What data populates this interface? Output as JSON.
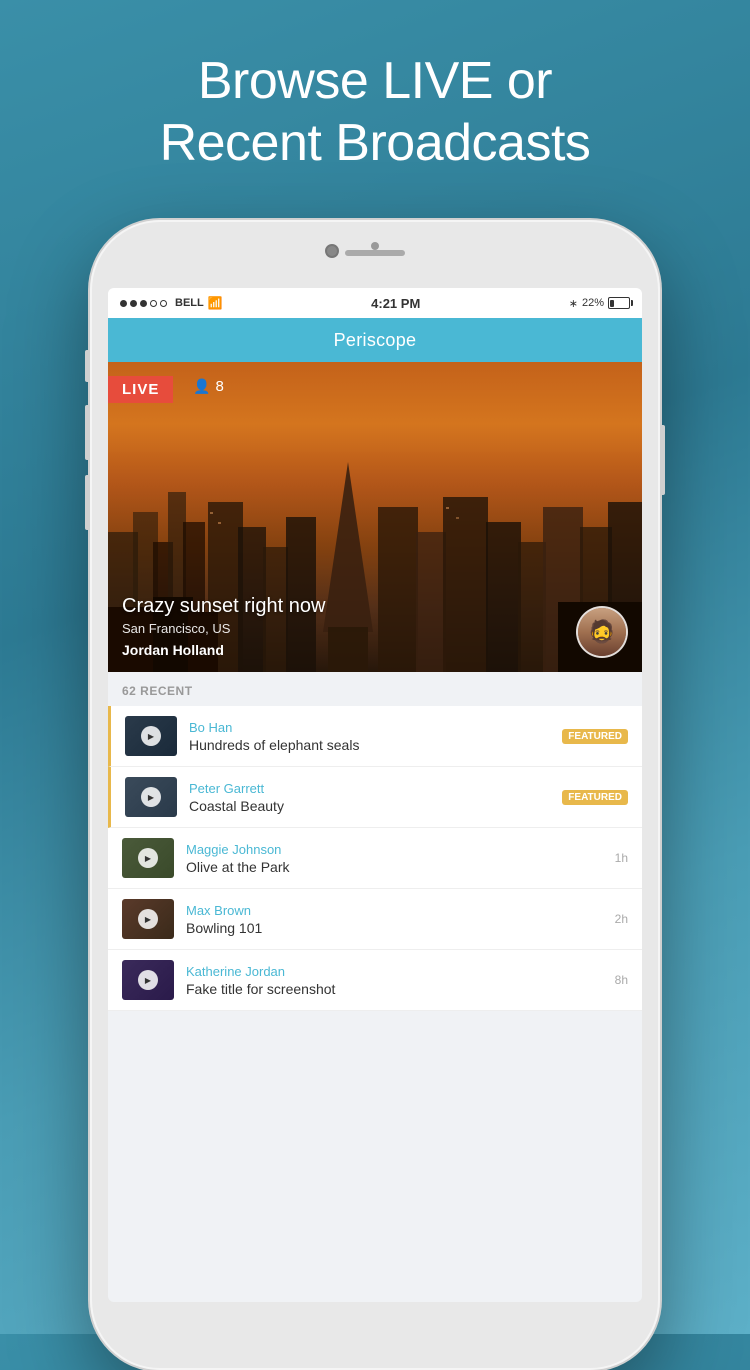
{
  "page": {
    "header_line1": "Browse LIVE or",
    "header_line2": "Recent Broadcasts"
  },
  "status_bar": {
    "dots": [
      "filled",
      "filled",
      "filled",
      "empty",
      "empty"
    ],
    "carrier": "BELL",
    "wifi": "wifi",
    "time": "4:21 PM",
    "bluetooth": "bluetooth",
    "battery_percent": "22%"
  },
  "app": {
    "title": "Periscope"
  },
  "live_broadcast": {
    "badge": "LIVE",
    "viewer_count": "8",
    "title": "Crazy sunset right now",
    "location": "San Francisco, US",
    "username": "Jordan Holland"
  },
  "recent": {
    "header": "62 RECENT",
    "items": [
      {
        "id": 1,
        "user": "Bo Han",
        "title": "Hundreds of elephant seals",
        "featured": true,
        "time": ""
      },
      {
        "id": 2,
        "user": "Peter Garrett",
        "title": "Coastal Beauty",
        "featured": true,
        "time": ""
      },
      {
        "id": 3,
        "user": "Maggie Johnson",
        "title": "Olive at the Park",
        "featured": false,
        "time": "1h"
      },
      {
        "id": 4,
        "user": "Max Brown",
        "title": "Bowling 101",
        "featured": false,
        "time": "2h"
      },
      {
        "id": 5,
        "user": "Katherine Jordan",
        "title": "Fake title for screenshot",
        "featured": false,
        "time": "8h"
      }
    ]
  },
  "icons": {
    "play": "▶",
    "viewer": "👤",
    "bluetooth": "B"
  },
  "colors": {
    "accent": "#4ab8d4",
    "live_red": "#e74c3c",
    "featured_gold": "#e8b84b"
  }
}
